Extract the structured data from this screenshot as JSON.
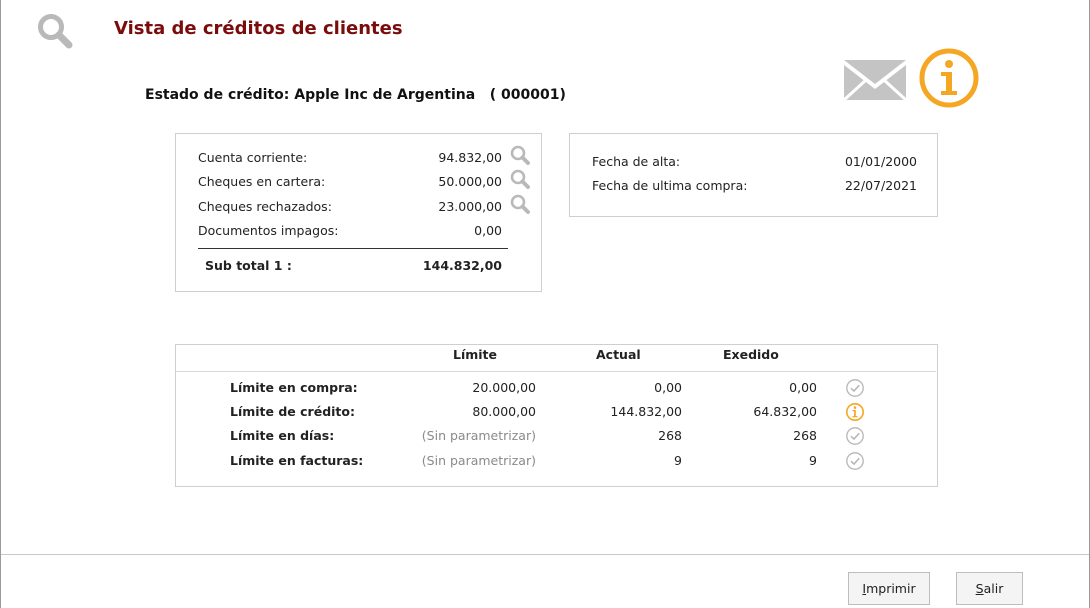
{
  "title": "Vista de créditos de clientes",
  "customer_header": "Estado de crédito: Apple Inc de Argentina   ( 000001)",
  "balances": [
    {
      "label": "Cuenta corriente:",
      "value": "94.832,00",
      "icon": "magnifier-icon"
    },
    {
      "label": "Cheques en cartera:",
      "value": "50.000,00",
      "icon": "magnifier-icon"
    },
    {
      "label": "Cheques rechazados:",
      "value": "23.000,00",
      "icon": "magnifier-icon"
    },
    {
      "label": "Documentos impagos:",
      "value": "0,00",
      "icon": ""
    }
  ],
  "subtotal": {
    "label": "Sub total 1 :",
    "value": "144.832,00"
  },
  "dates": [
    {
      "label": "Fecha de alta:",
      "value": "01/01/2000"
    },
    {
      "label": "Fecha de ultima compra:",
      "value": "22/07/2021"
    }
  ],
  "limits_table": {
    "columns": [
      "Límite",
      "Actual",
      "Exedido"
    ],
    "rows": [
      {
        "label": "Límite en compra:",
        "limit": "20.000,00",
        "actual": "0,00",
        "exceeded": "0,00",
        "status": "ok",
        "unset": false
      },
      {
        "label": "Límite de crédito:",
        "limit": "80.000,00",
        "actual": "144.832,00",
        "exceeded": "64.832,00",
        "status": "warning",
        "unset": false
      },
      {
        "label": "Límite en días:",
        "limit": "(Sin parametrizar)",
        "actual": "268",
        "exceeded": "268",
        "status": "ok",
        "unset": true
      },
      {
        "label": "Límite en facturas:",
        "limit": "(Sin parametrizar)",
        "actual": "9",
        "exceeded": "9",
        "status": "ok",
        "unset": true
      }
    ]
  },
  "buttons": {
    "print": {
      "accel": "I",
      "rest": "mprimir"
    },
    "exit": {
      "accel": "S",
      "rest": "alir"
    }
  },
  "colors": {
    "title": "#7a0c0c",
    "warning": "#f5a623",
    "ok": "#b5b5b5",
    "mail": "#c4c4c4"
  }
}
